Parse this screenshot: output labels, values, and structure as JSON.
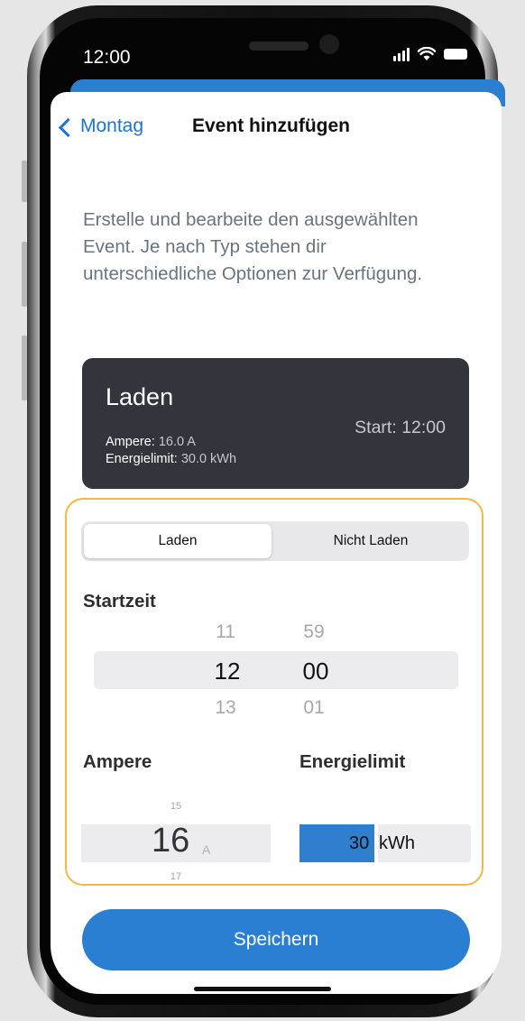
{
  "status_bar": {
    "time": "12:00"
  },
  "nav": {
    "back_label": "Montag",
    "title": "Event hinzufügen"
  },
  "description": "Erstelle und bearbeite den ausgewählten Event. Je nach Typ stehen dir unterschiedliche Optionen zur Verfügung.",
  "event_card": {
    "title": "Laden",
    "start_label": "Start:",
    "start_value": "12:00",
    "ampere_label": "Ampere:",
    "ampere_value": "16.0 A",
    "energy_label": "Energielimit:",
    "energy_value": "30.0 kWh"
  },
  "segmented": {
    "options": [
      "Laden",
      "Nicht Laden"
    ],
    "selected": "Laden"
  },
  "startzeit": {
    "label": "Startzeit",
    "hours": {
      "prev": "11",
      "current": "12",
      "next": "13"
    },
    "minutes": {
      "prev": "59",
      "current": "00",
      "next": "01"
    }
  },
  "ampere": {
    "label": "Ampere",
    "prev": "15",
    "current": "16",
    "next": "17",
    "unit": "A"
  },
  "energielimit": {
    "label": "Energielimit",
    "value": "30",
    "unit": "kWh",
    "fill_fraction": 0.44
  },
  "save_button": "Speichern",
  "colors": {
    "accent": "#2a7fd2",
    "card": "#34343c",
    "highlight_border": "#f5b843"
  }
}
